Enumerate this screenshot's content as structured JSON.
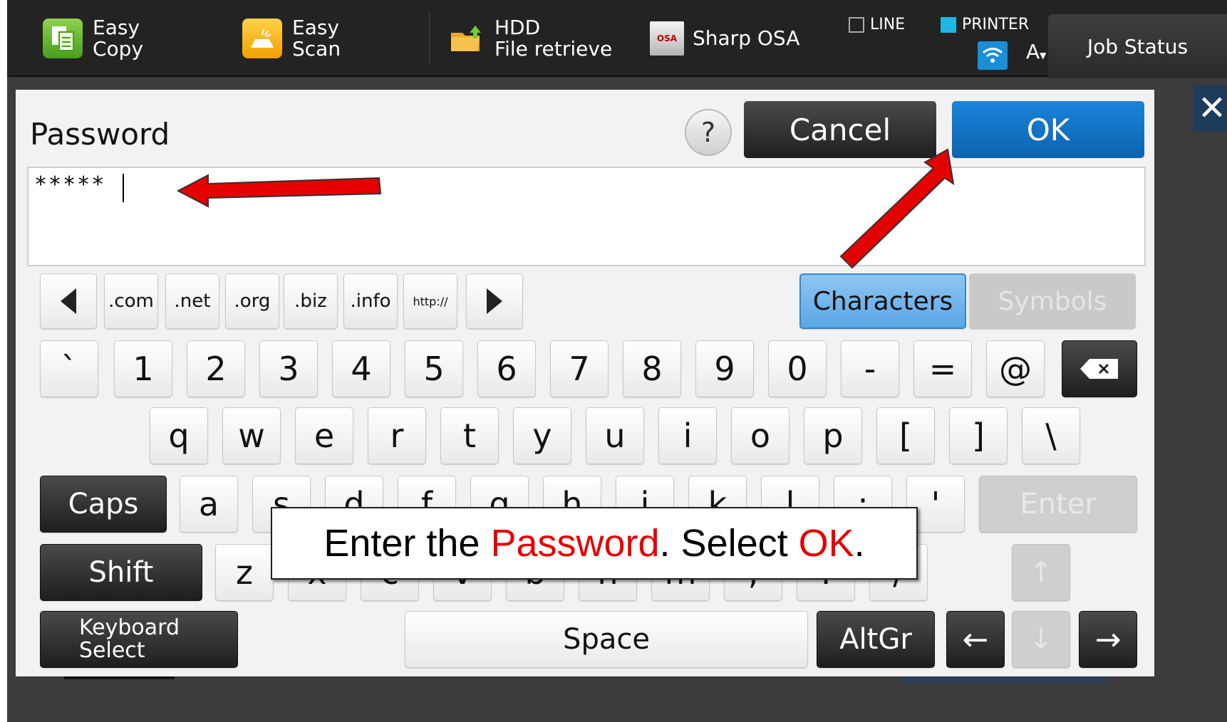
{
  "topbar": {
    "easy_copy": "Easy\nCopy",
    "easy_scan": "Easy\nScan",
    "hdd": "HDD\nFile retrieve",
    "sharp_osa": "Sharp OSA",
    "sharp_osa_icon_text": "OSA",
    "line_label": "LINE",
    "printer_label": "PRINTER",
    "font_indicator": "A",
    "job_status": "Job Status"
  },
  "dialog": {
    "title": "Password",
    "help": "?",
    "cancel": "Cancel",
    "ok": "OK",
    "password_value": "*****"
  },
  "keyboard": {
    "domain_keys": [
      ".com",
      ".net",
      ".org",
      ".biz",
      ".info",
      "http://"
    ],
    "tab_characters": "Characters",
    "tab_symbols": "Symbols",
    "row1": [
      "`",
      "1",
      "2",
      "3",
      "4",
      "5",
      "6",
      "7",
      "8",
      "9",
      "0",
      "-",
      "=",
      "@"
    ],
    "row2": [
      "q",
      "w",
      "e",
      "r",
      "t",
      "y",
      "u",
      "i",
      "o",
      "p",
      "[",
      "]",
      "\\"
    ],
    "row3": [
      "a",
      "s",
      "d",
      "f",
      "g",
      "h",
      "j",
      "k",
      "l",
      ";",
      "'"
    ],
    "row4": [
      "z",
      "x",
      "c",
      "v",
      "b",
      "n",
      "m",
      ",",
      ".",
      "/"
    ],
    "caps": "Caps",
    "enter": "Enter",
    "shift": "Shift",
    "keyboard_select": "Keyboard\nSelect",
    "space": "Space",
    "altgr": "AltGr",
    "backspace_icon": "backspace-icon"
  },
  "callout": {
    "part1": "Enter the ",
    "part2": "Password",
    "part3": ". Select ",
    "part4": "OK",
    "part5": "."
  },
  "colors": {
    "accent_blue": "#0c63b0",
    "annotation_red": "#e50000"
  }
}
